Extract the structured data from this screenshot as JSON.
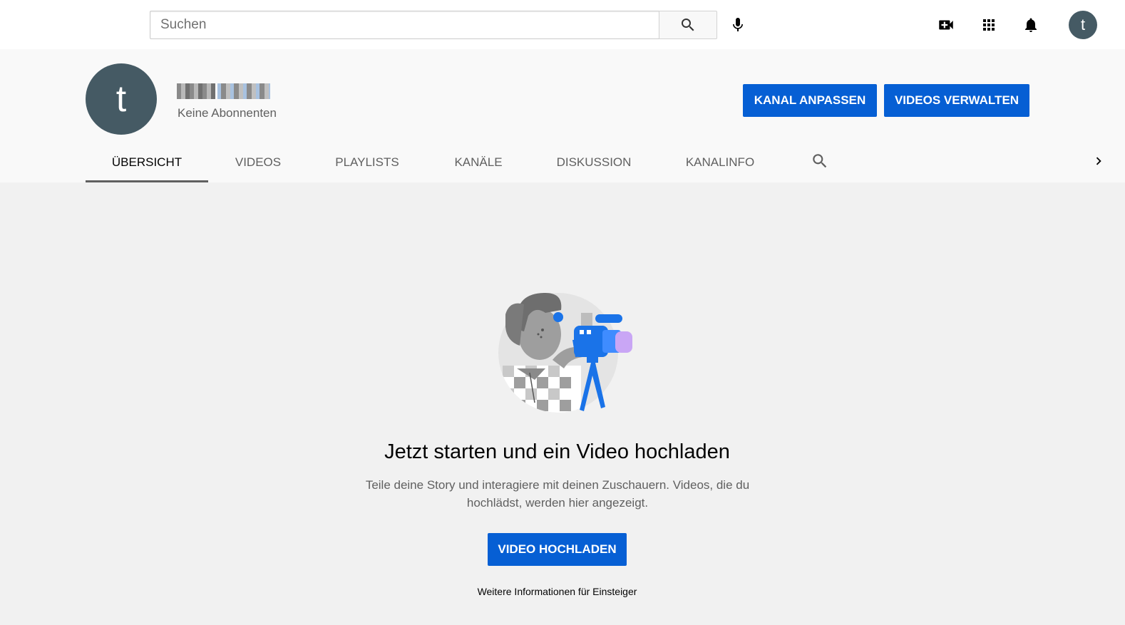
{
  "topbar": {
    "search_placeholder": "Suchen",
    "icons": [
      "search-icon",
      "mic-icon",
      "create-video-icon",
      "apps-grid-icon",
      "notifications-bell-icon"
    ],
    "avatar_letter": "t"
  },
  "channel": {
    "avatar_letter": "t",
    "subscribers": "Keine Abonnenten",
    "customize_label": "KANAL ANPASSEN",
    "manage_label": "VIDEOS VERWALTEN"
  },
  "tabs": [
    {
      "label": "ÜBERSICHT",
      "active": true
    },
    {
      "label": "VIDEOS",
      "active": false
    },
    {
      "label": "PLAYLISTS",
      "active": false
    },
    {
      "label": "KANÄLE",
      "active": false
    },
    {
      "label": "DISKUSSION",
      "active": false
    },
    {
      "label": "KANALINFO",
      "active": false
    }
  ],
  "empty_state": {
    "title": "Jetzt starten und ein Video hochladen",
    "description": "Teile deine Story und interagiere mit deinen Zuschauern. Videos, die du hochlädst, werden hier angezeigt.",
    "upload_label": "VIDEO HOCHLADEN",
    "more_info": "Weitere Informationen für Einsteiger"
  },
  "colors": {
    "accent": "#065fd4",
    "avatar": "#455a64"
  }
}
